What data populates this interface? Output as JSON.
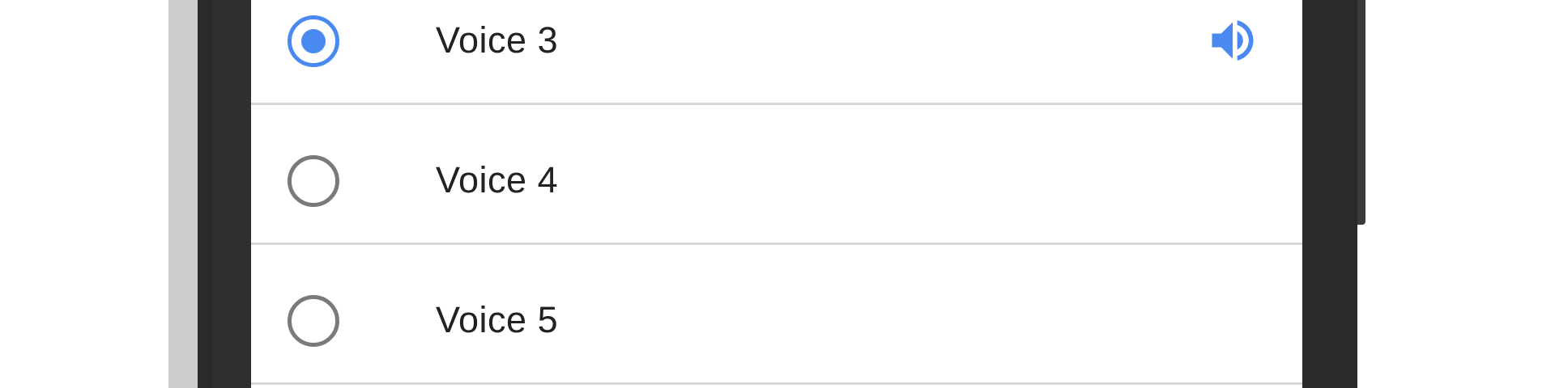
{
  "voices": [
    {
      "label": "Voice 3",
      "selected": true,
      "playing": true
    },
    {
      "label": "Voice 4",
      "selected": false,
      "playing": false
    },
    {
      "label": "Voice 5",
      "selected": false,
      "playing": false
    }
  ],
  "icons": {
    "radio_checked": "radio-checked-icon",
    "radio_unchecked": "radio-unchecked-icon",
    "speaker": "volume-up-icon"
  },
  "colors": {
    "accent": "#4a89f0",
    "radio_off": "#7a7a7a",
    "divider": "#d8d8d8",
    "text": "#222222",
    "frame": "#2a2a2a",
    "side_strip": "#cdcdcd"
  }
}
